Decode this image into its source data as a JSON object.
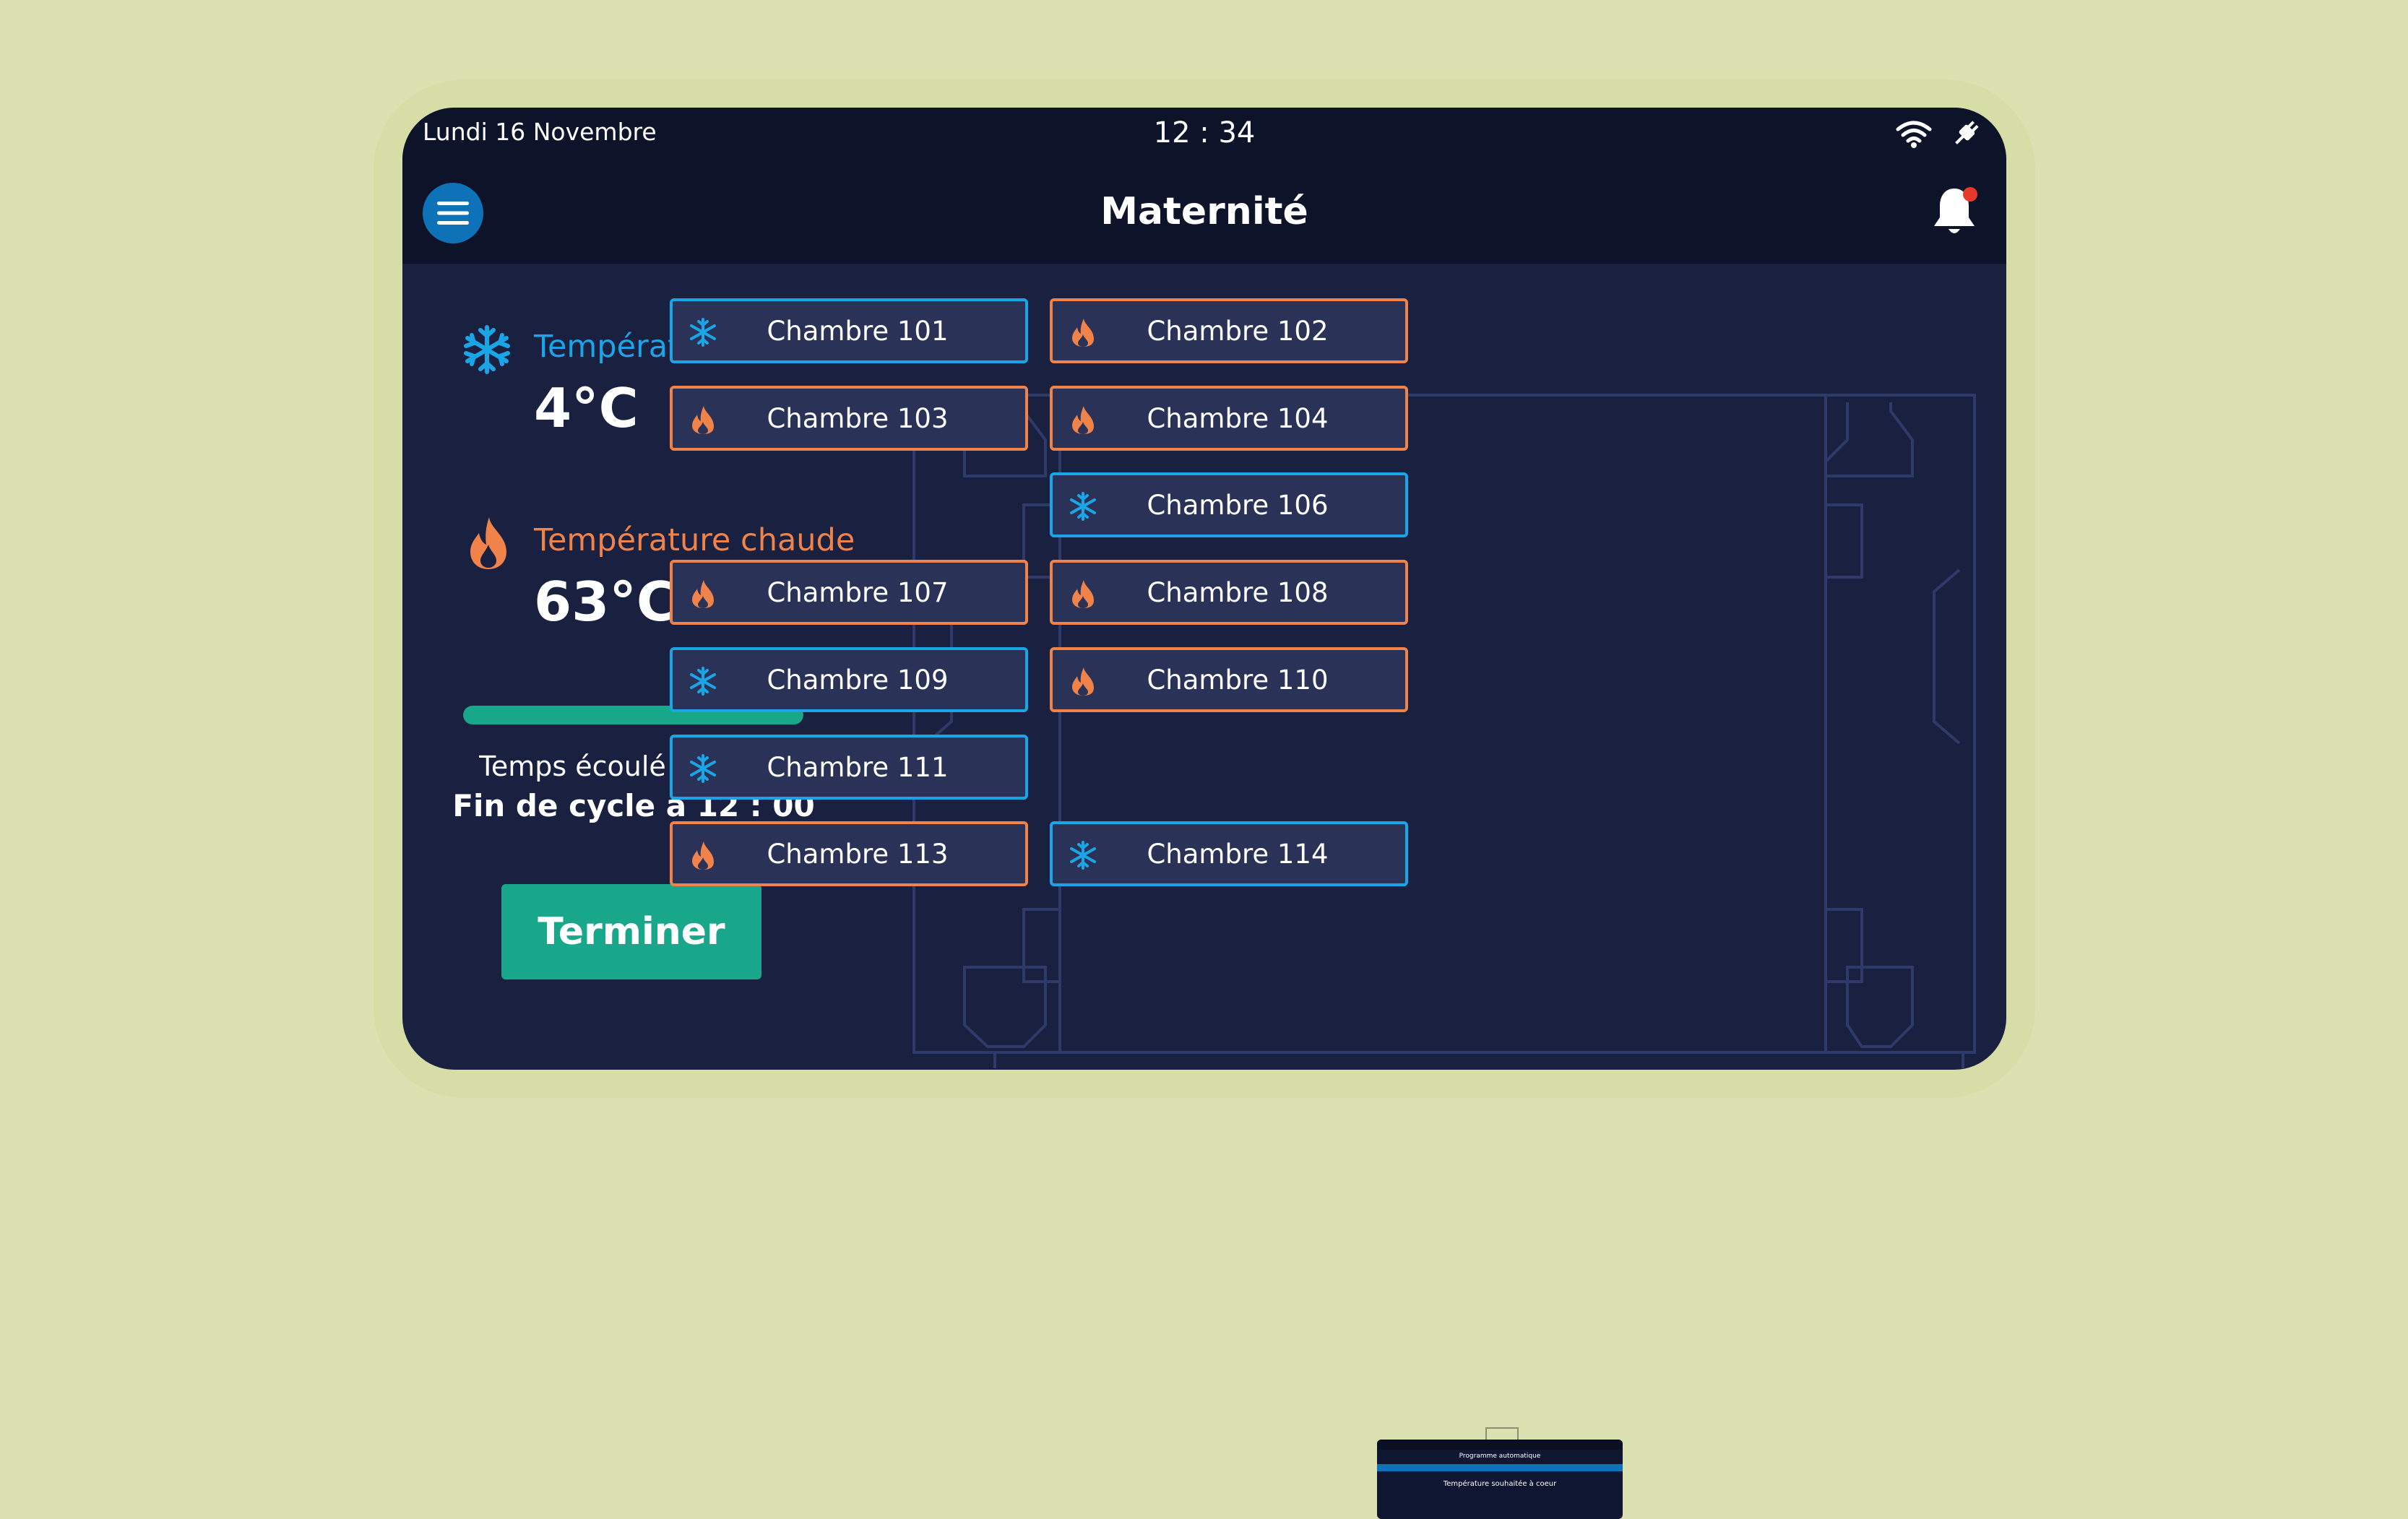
{
  "status_bar": {
    "date": "Lundi 16 Novembre",
    "time": "12 : 34",
    "icons": [
      "wifi-icon",
      "plug-icon"
    ]
  },
  "app_bar": {
    "title": "Maternité",
    "menu_icon": "hamburger-menu-icon",
    "notification_icon": "bell-icon",
    "has_unread_notification": true
  },
  "cold": {
    "label": "Température froide",
    "value": "4°C",
    "icon": "snowflake-icon",
    "color": "#1aa6e6"
  },
  "hot": {
    "label": "Température chaude",
    "value": "63°C",
    "icon": "flame-icon",
    "color": "#f0834a"
  },
  "cycle": {
    "progress_fraction": 1.0,
    "elapsed_text": "Temps écoulé : 20 min",
    "end_text": "Fin de cycle à 12 : 00"
  },
  "finish_button": {
    "label": "Terminer",
    "color": "#19a78b"
  },
  "rooms": [
    {
      "label": "Chambre 101",
      "mode": "cold"
    },
    {
      "label": "Chambre 102",
      "mode": "hot"
    },
    {
      "label": "Chambre 103",
      "mode": "hot"
    },
    {
      "label": "Chambre 104",
      "mode": "hot"
    },
    {
      "label": "Chambre 106",
      "mode": "cold"
    },
    {
      "label": "Chambre 107",
      "mode": "hot"
    },
    {
      "label": "Chambre 108",
      "mode": "hot"
    },
    {
      "label": "Chambre 109",
      "mode": "cold"
    },
    {
      "label": "Chambre 110",
      "mode": "hot"
    },
    {
      "label": "Chambre 111",
      "mode": "cold"
    },
    {
      "label": "Chambre 113",
      "mode": "hot"
    },
    {
      "label": "Chambre 114",
      "mode": "cold"
    }
  ],
  "thumbnail": {
    "title": "Programme automatique",
    "subtitle": "Température souhaitée à coeur"
  }
}
